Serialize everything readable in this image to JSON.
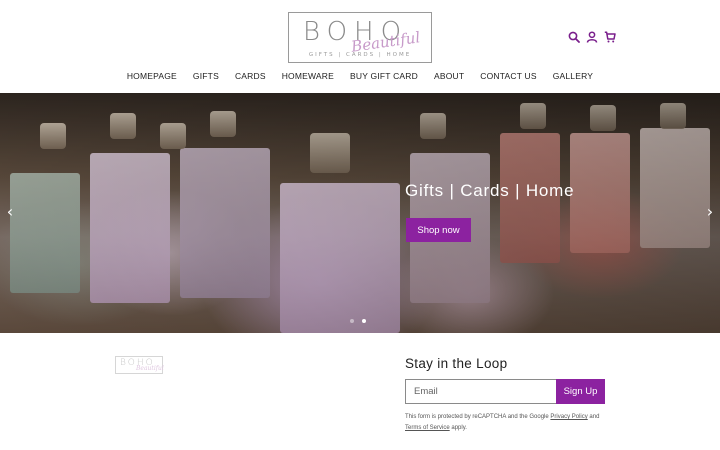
{
  "header": {
    "logo": {
      "main": "BOHO",
      "script": "Beautiful",
      "tagline": "GIFTS | CARDS | HOME"
    },
    "icons": [
      "search-icon",
      "account-icon",
      "cart-icon"
    ],
    "nav": [
      "HOMEPAGE",
      "GIFTS",
      "CARDS",
      "HOMEWARE",
      "BUY GIFT CARD",
      "ABOUT",
      "CONTACT US",
      "GALLERY"
    ]
  },
  "hero": {
    "title": "Gifts | Cards | Home",
    "button": "Shop now",
    "prev_icon": "‹",
    "next_icon": "›",
    "slides_total": 2,
    "active_slide": 2
  },
  "footer": {
    "logo": {
      "main": "BOHO",
      "script": "Beautiful"
    },
    "newsletter": {
      "title": "Stay in the Loop",
      "email_placeholder": "Email",
      "button": "Sign Up",
      "recaptcha_prefix": "This form is protected by reCAPTCHA and the Google",
      "privacy_link": "Privacy Policy",
      "and": "and",
      "terms_link": "Terms of Service",
      "suffix": "apply."
    }
  },
  "colors": {
    "accent": "#8c22a0",
    "logo_script": "#c79ac9"
  }
}
